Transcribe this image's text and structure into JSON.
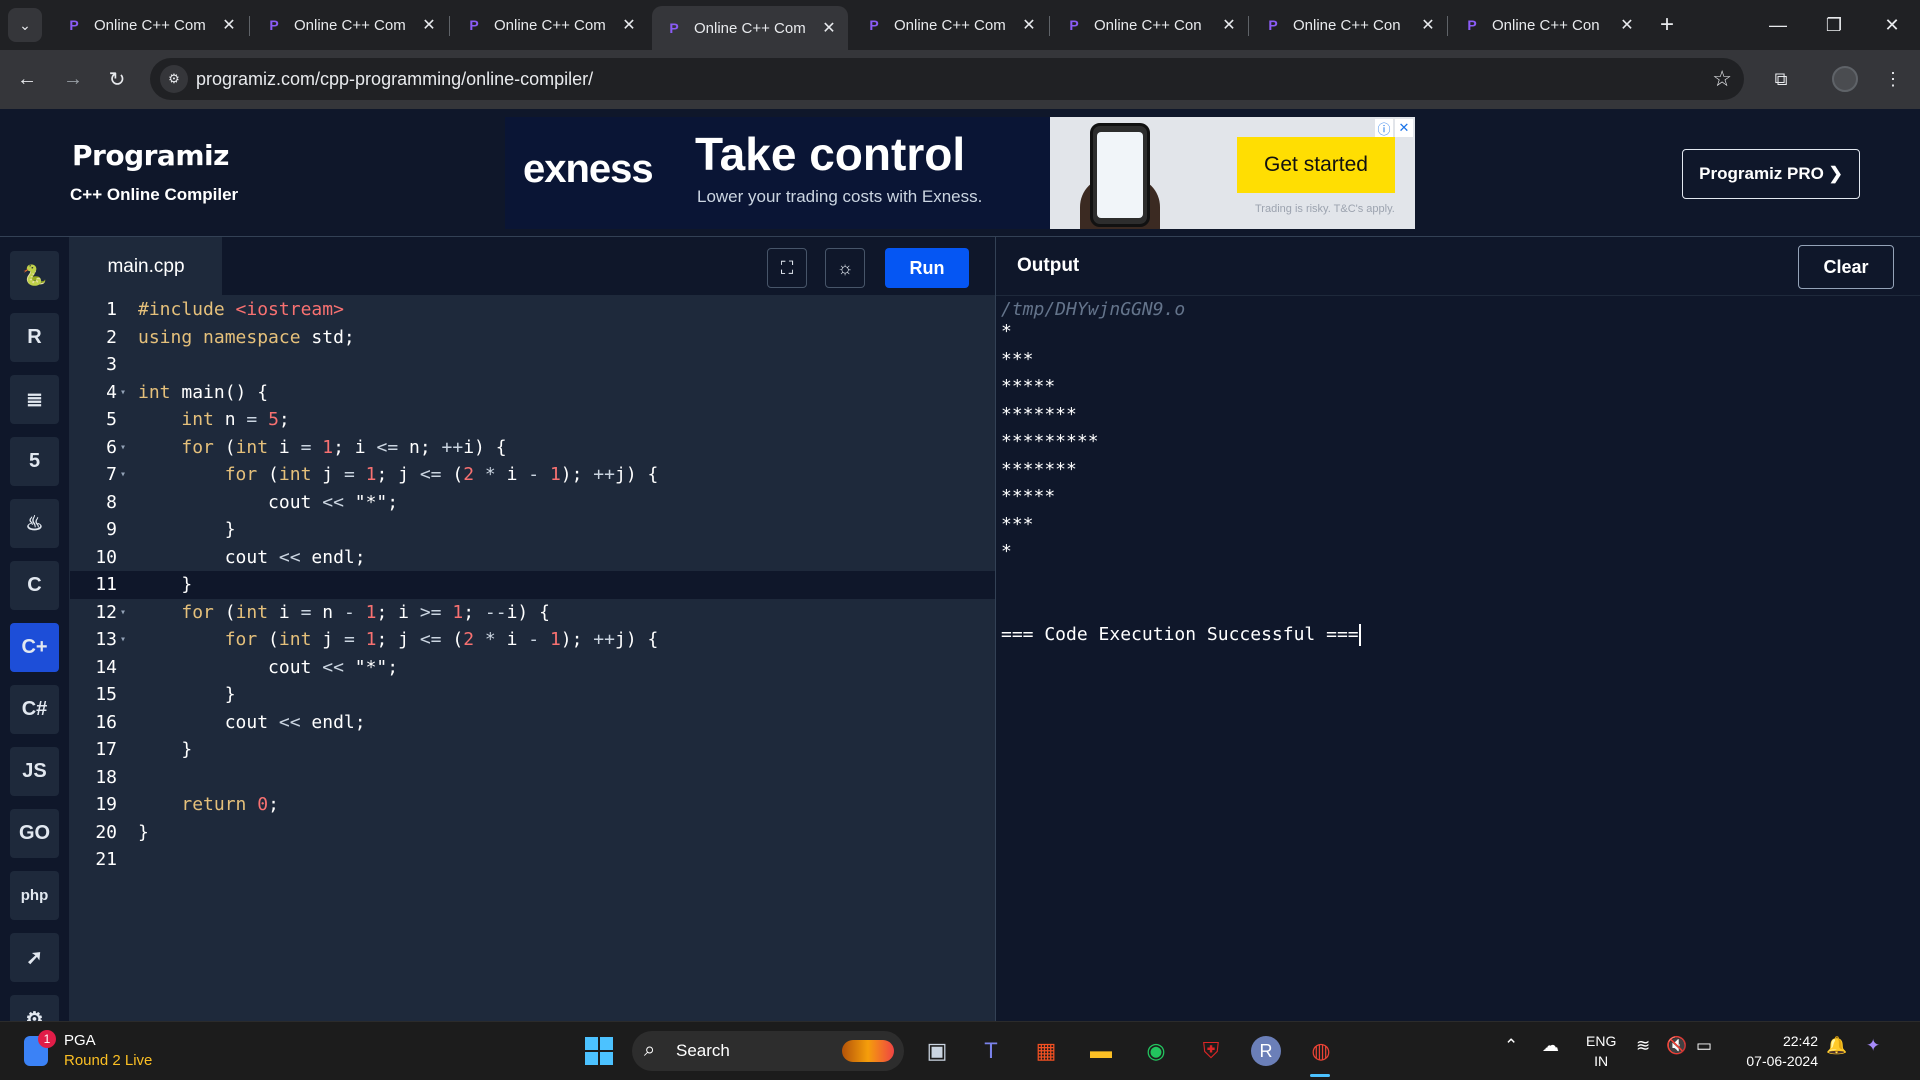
{
  "browser": {
    "tabs": [
      {
        "title": "Online C++ Com",
        "active": false
      },
      {
        "title": "Online C++ Com",
        "active": false
      },
      {
        "title": "Online C++ Com",
        "active": false
      },
      {
        "title": "Online C++ Com",
        "active": true
      },
      {
        "title": "Online C++ Com",
        "active": false
      },
      {
        "title": "Online C++ Con",
        "active": false
      },
      {
        "title": "Online C++ Con",
        "active": false
      },
      {
        "title": "Online C++ Con",
        "active": false
      }
    ],
    "url": "programiz.com/cpp-programming/online-compiler/"
  },
  "header": {
    "logo": "Programiz",
    "subtitle": "C++ Online Compiler",
    "pro_button": "Programiz PRO ❯"
  },
  "ad": {
    "brand": "exness",
    "headline": "Take control",
    "subline": "Lower your trading costs with Exness.",
    "cta": "Get started",
    "disclaimer": "Trading is risky. T&C's apply."
  },
  "sidebar": {
    "languages": [
      {
        "name": "python",
        "glyph": "🐍",
        "active": false
      },
      {
        "name": "r",
        "glyph": "R",
        "active": false
      },
      {
        "name": "sql",
        "glyph": "≣",
        "active": false
      },
      {
        "name": "html",
        "glyph": "5",
        "active": false
      },
      {
        "name": "java",
        "glyph": "♨",
        "active": false
      },
      {
        "name": "c",
        "glyph": "C",
        "active": false
      },
      {
        "name": "cpp",
        "glyph": "C+",
        "active": true
      },
      {
        "name": "csharp",
        "glyph": "C#",
        "active": false
      },
      {
        "name": "javascript",
        "glyph": "JS",
        "active": false
      },
      {
        "name": "go",
        "glyph": "GO",
        "active": false
      },
      {
        "name": "php",
        "glyph": "php",
        "active": false
      },
      {
        "name": "swift",
        "glyph": "➚",
        "active": false
      },
      {
        "name": "rust",
        "glyph": "⚙",
        "active": false
      }
    ]
  },
  "editor": {
    "filename": "main.cpp",
    "run_label": "Run",
    "current_line": 11,
    "lines": [
      {
        "n": "1",
        "fold": false,
        "html": "<span class='kw'>#include</span> <span class='str'>&lt;iostream&gt;</span>"
      },
      {
        "n": "2",
        "fold": false,
        "html": "<span class='kw'>using namespace</span> std;"
      },
      {
        "n": "3",
        "fold": false,
        "html": ""
      },
      {
        "n": "4",
        "fold": true,
        "html": "<span class='kw'>int</span> main() {"
      },
      {
        "n": "5",
        "fold": false,
        "html": "    <span class='kw'>int</span> n <span class='op'>=</span> <span class='num'>5</span>;"
      },
      {
        "n": "6",
        "fold": true,
        "html": "    <span class='kw'>for</span> (<span class='kw'>int</span> i <span class='op'>=</span> <span class='num'>1</span>; i <span class='op'>&lt;=</span> n; <span class='op'>++</span>i) {"
      },
      {
        "n": "7",
        "fold": true,
        "html": "        <span class='kw'>for</span> (<span class='kw'>int</span> j <span class='op'>=</span> <span class='num'>1</span>; j <span class='op'>&lt;=</span> (<span class='num'>2</span> <span class='op'>*</span> i <span class='op'>-</span> <span class='num'>1</span>); <span class='op'>++</span>j) {"
      },
      {
        "n": "8",
        "fold": false,
        "html": "            cout <span class='op'>&lt;&lt;</span> \"*\";"
      },
      {
        "n": "9",
        "fold": false,
        "html": "        }"
      },
      {
        "n": "10",
        "fold": false,
        "html": "        cout <span class='op'>&lt;&lt;</span> endl;"
      },
      {
        "n": "11",
        "fold": false,
        "html": "    }"
      },
      {
        "n": "12",
        "fold": true,
        "html": "    <span class='kw'>for</span> (<span class='kw'>int</span> i <span class='op'>=</span> n <span class='op'>-</span> <span class='num'>1</span>; i <span class='op'>&gt;=</span> <span class='num'>1</span>; <span class='op'>--</span>i) {"
      },
      {
        "n": "13",
        "fold": true,
        "html": "        <span class='kw'>for</span> (<span class='kw'>int</span> j <span class='op'>=</span> <span class='num'>1</span>; j <span class='op'>&lt;=</span> (<span class='num'>2</span> <span class='op'>*</span> i <span class='op'>-</span> <span class='num'>1</span>); <span class='op'>++</span>j) {"
      },
      {
        "n": "14",
        "fold": false,
        "html": "            cout <span class='op'>&lt;&lt;</span> \"*\";"
      },
      {
        "n": "15",
        "fold": false,
        "html": "        }"
      },
      {
        "n": "16",
        "fold": false,
        "html": "        cout <span class='op'>&lt;&lt;</span> endl;"
      },
      {
        "n": "17",
        "fold": false,
        "html": "    }"
      },
      {
        "n": "18",
        "fold": false,
        "html": ""
      },
      {
        "n": "19",
        "fold": false,
        "html": "    <span class='kw'>return</span> <span class='num'>0</span>;"
      },
      {
        "n": "20",
        "fold": false,
        "html": "}"
      },
      {
        "n": "21",
        "fold": false,
        "html": ""
      }
    ]
  },
  "output": {
    "title": "Output",
    "clear_label": "Clear",
    "path": "/tmp/DHYwjnGGN9.o",
    "lines": [
      "*",
      "***",
      "*****",
      "*******",
      "*********",
      "*******",
      "*****",
      "***",
      "*",
      "",
      "",
      "=== Code Execution Successful ==="
    ]
  },
  "taskbar": {
    "weather_title": "PGA",
    "weather_sub": "Round 2 Live",
    "weather_badge": "1",
    "search_label": "Search",
    "lang_line1": "ENG",
    "lang_line2": "IN",
    "time": "22:42",
    "date": "07-06-2024"
  }
}
